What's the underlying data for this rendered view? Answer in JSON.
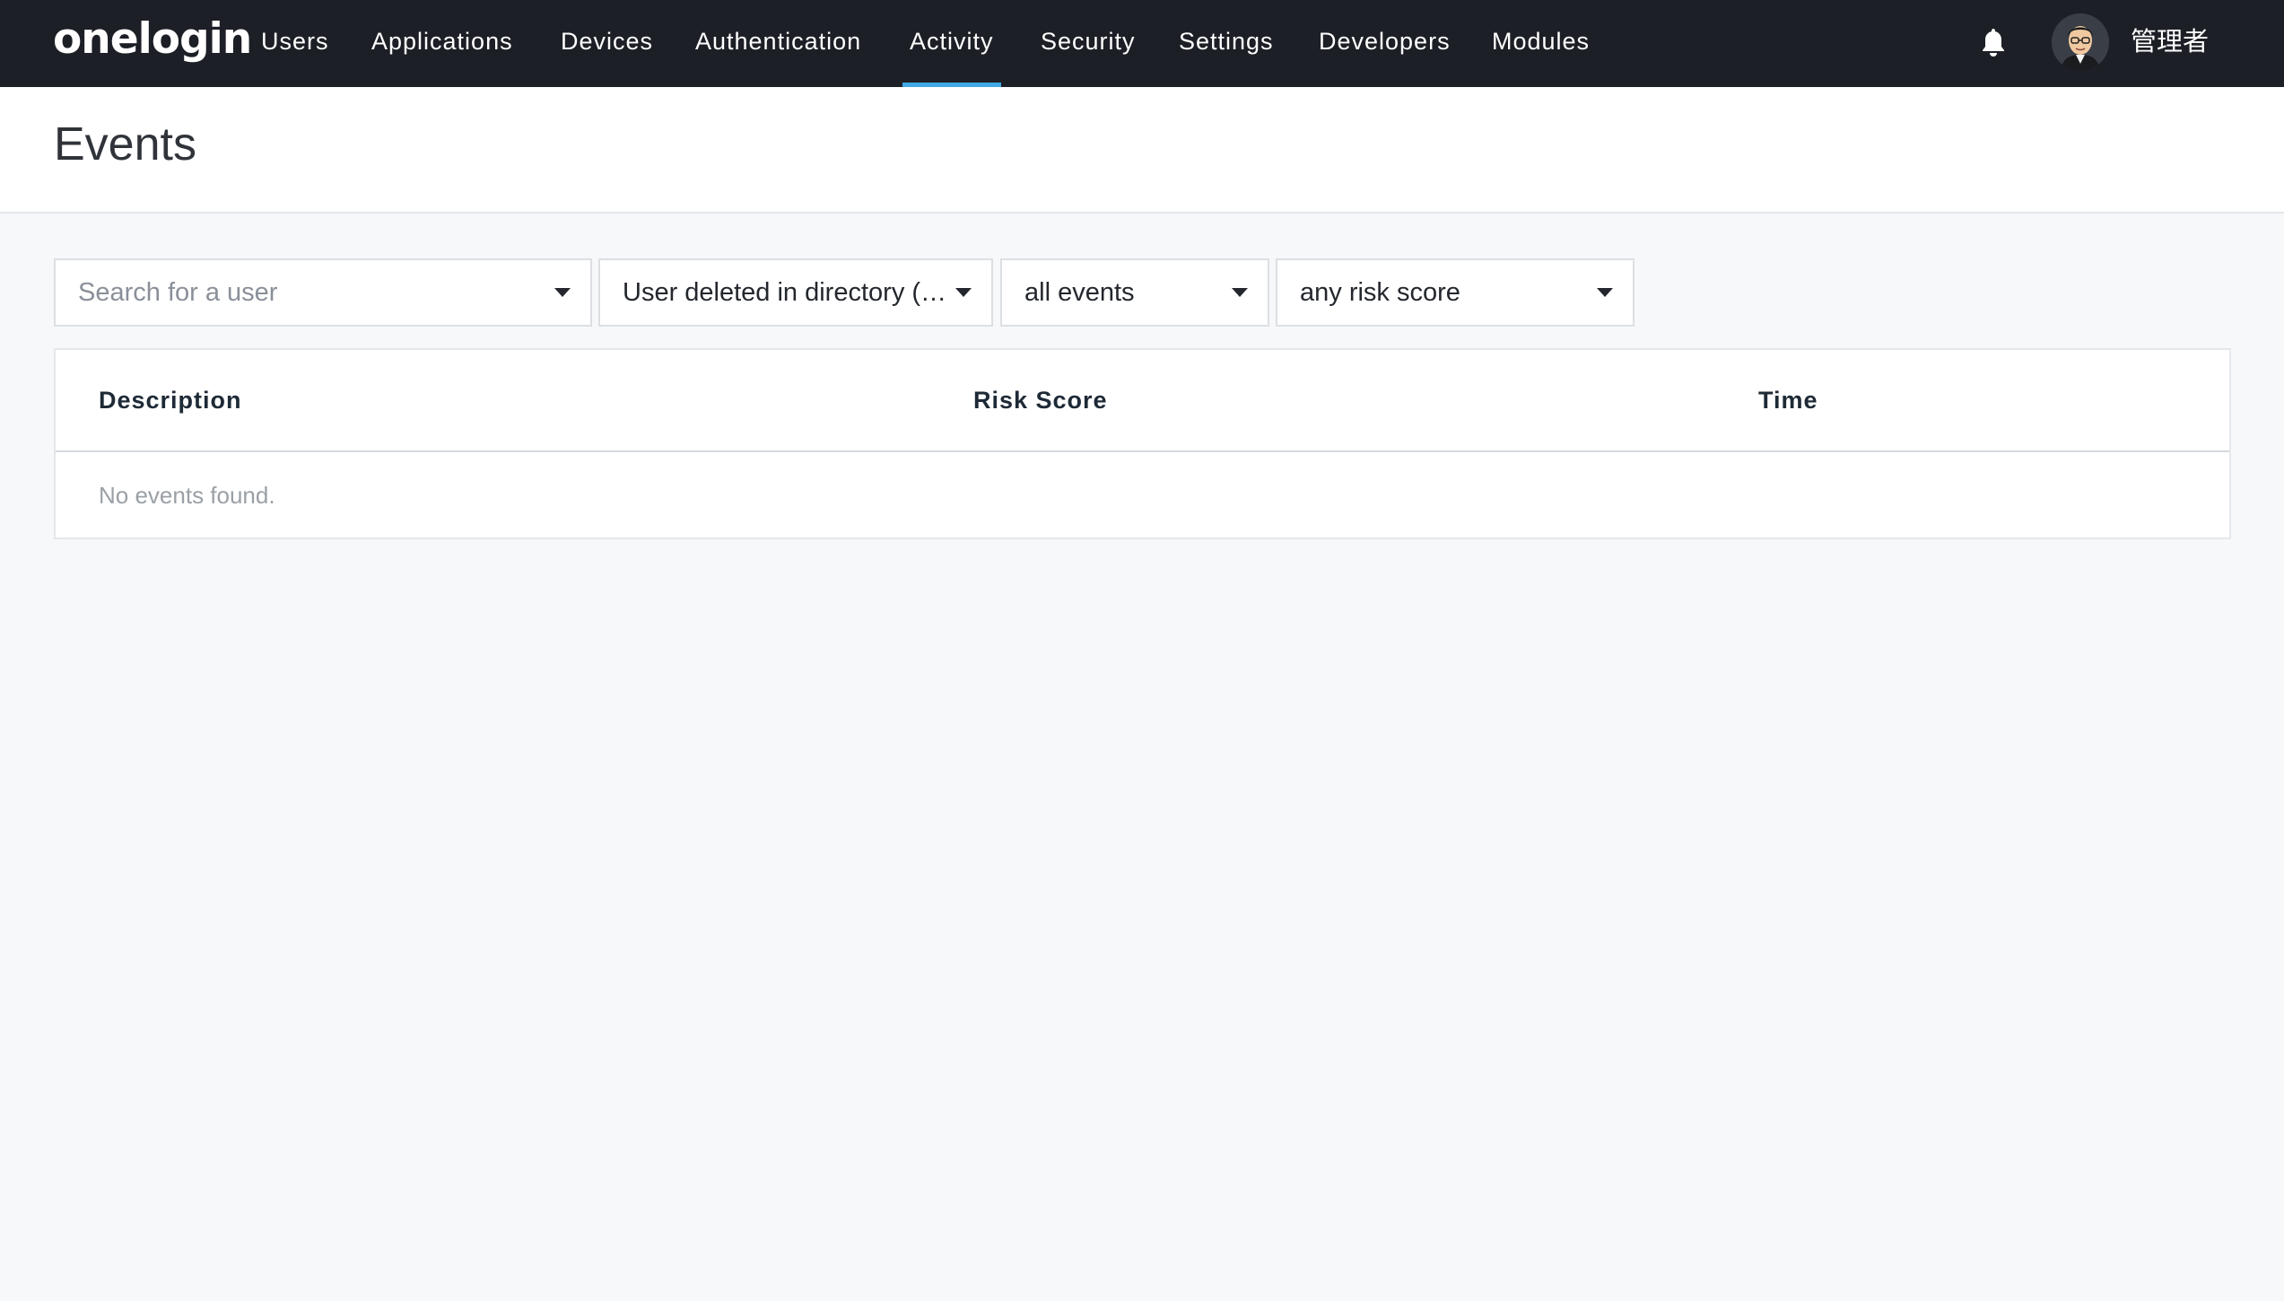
{
  "nav": {
    "logo": "onelogin",
    "items": [
      {
        "label": "Users"
      },
      {
        "label": "Applications"
      },
      {
        "label": "Devices"
      },
      {
        "label": "Authentication"
      },
      {
        "label": "Activity"
      },
      {
        "label": "Security"
      },
      {
        "label": "Settings"
      },
      {
        "label": "Developers"
      },
      {
        "label": "Modules"
      }
    ],
    "active_item": "Activity",
    "bell_icon": "bell-icon",
    "user_name": "管理者"
  },
  "page": {
    "title": "Events"
  },
  "filters": {
    "user_search": {
      "placeholder": "Search for a user",
      "value": ""
    },
    "event_type": {
      "value": "User deleted in directory (…"
    },
    "event_scope": {
      "value": "all events"
    },
    "risk_score": {
      "value": "any risk score"
    }
  },
  "table": {
    "columns": [
      "Description",
      "Risk Score",
      "Time"
    ],
    "rows": [],
    "empty_message": "No events found."
  },
  "colors": {
    "nav_background": "#1c1f26",
    "active_underline": "#3fa8e6",
    "page_background": "#f7f8fa"
  }
}
